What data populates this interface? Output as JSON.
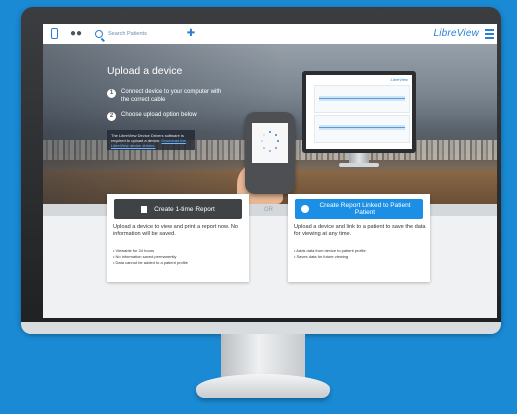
{
  "app": {
    "brand": "LibreView"
  },
  "topbar": {
    "search_placeholder": "Search Patients"
  },
  "hero": {
    "title": "Upload a device",
    "steps": [
      {
        "number": "1",
        "text": "Connect device to your computer with the correct cable"
      },
      {
        "number": "2",
        "text": "Choose upload option below"
      }
    ],
    "notice_text": "The LibreView Device Drivers software is required to upload a device.",
    "notice_link": "Download the LibreView device drivers.",
    "mini_brand": "LibreView"
  },
  "options": {
    "or_label": "OR",
    "one_time": {
      "button_label": "Create 1-time Report",
      "description": "Upload a device to view and print a report now. No information will be saved.",
      "bullets": [
        "Viewable for 24 hours",
        "No information saved permanently",
        "Data cannot be added to a patient profile"
      ]
    },
    "linked": {
      "button_label": "Create Report Linked to Patient Patient",
      "description": "Upload a device and link to a patient to save the data for viewing at any time.",
      "bullets": [
        "Adds data from device to patient profile",
        "Saves data for future viewing"
      ]
    }
  },
  "colors": {
    "background": "#1a8ad4",
    "accent": "#1b8fe6",
    "dark_button": "#3f4346"
  }
}
